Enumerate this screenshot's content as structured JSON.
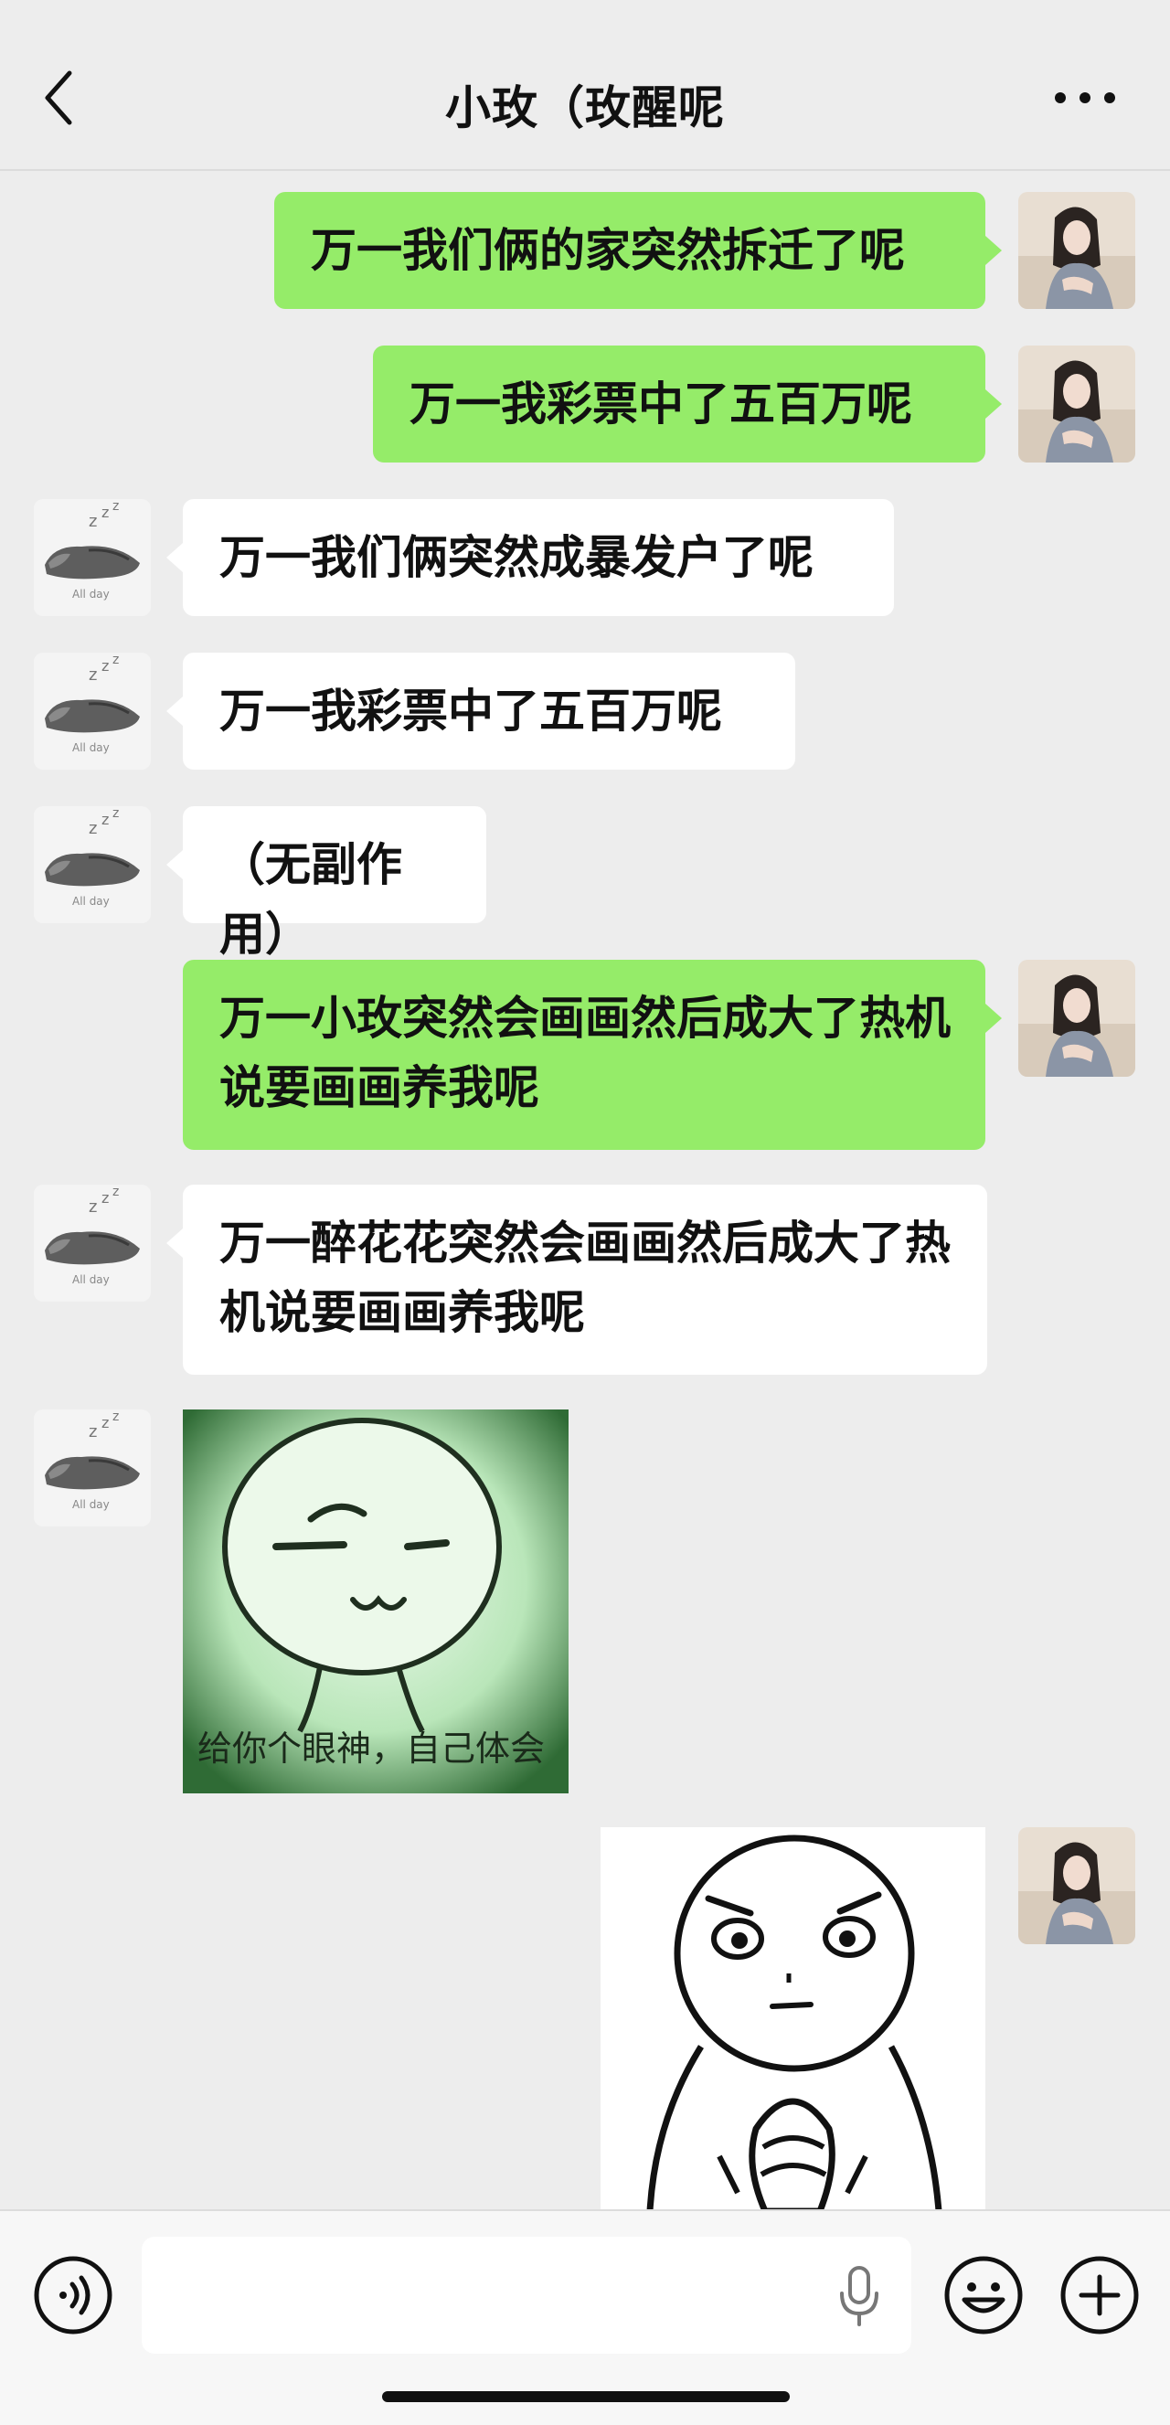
{
  "header": {
    "title": "小玫（玫醒呢",
    "back_icon": "chevron-left-icon",
    "more_icon": "more-dots-icon"
  },
  "messages": [
    {
      "side": "right",
      "type": "text",
      "text": "万一我们俩的家突然拆迁了呢"
    },
    {
      "side": "right",
      "type": "text",
      "text": "万一我彩票中了五百万呢"
    },
    {
      "side": "left",
      "type": "text",
      "text": "万一我们俩突然成暴发户了呢"
    },
    {
      "side": "left",
      "type": "text",
      "text": "万一我彩票中了五百万呢"
    },
    {
      "side": "left",
      "type": "text",
      "text": "（无副作用）"
    },
    {
      "side": "right",
      "type": "text",
      "text": "万一小玫突然会画画然后成大了热机说要画画养我呢"
    },
    {
      "side": "left",
      "type": "text",
      "text": "万一醉花花突然会画画然后成大了热机说要画画养我呢"
    },
    {
      "side": "left",
      "type": "sticker",
      "caption": "给你个眼神，自己体会"
    },
    {
      "side": "right",
      "type": "sticker",
      "caption": ""
    }
  ],
  "avatars": {
    "self": "girl-photo-avatar",
    "other": "sleeping-cat-avatar",
    "other_caption": "All day"
  },
  "input_bar": {
    "placeholder": "",
    "voice_icon": "voice-mode-icon",
    "mic_icon": "microphone-icon",
    "emoji_icon": "emoji-icon",
    "plus_icon": "plus-icon"
  },
  "colors": {
    "background": "#ededed",
    "outgoing_bubble": "#95ec69",
    "incoming_bubble": "#ffffff"
  }
}
